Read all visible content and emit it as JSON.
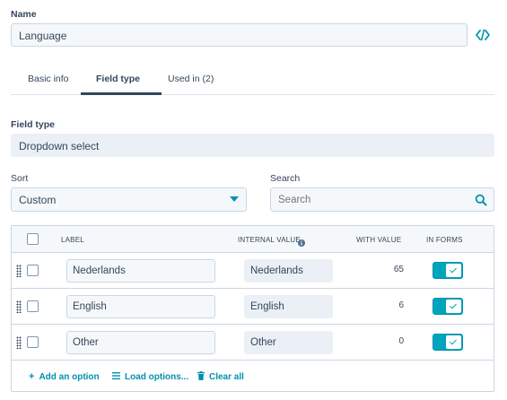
{
  "name_field": {
    "label": "Name",
    "value": "Language"
  },
  "tabs": [
    {
      "label": "Basic info"
    },
    {
      "label": "Field type"
    },
    {
      "label": "Used in (2)"
    }
  ],
  "field_type": {
    "label": "Field type",
    "value": "Dropdown select"
  },
  "sort": {
    "label": "Sort",
    "value": "Custom"
  },
  "search": {
    "label": "Search",
    "placeholder": "Search"
  },
  "table": {
    "headers": {
      "label": "LABEL",
      "internal_value": "INTERNAL VALUE",
      "with_value": "WITH VALUE",
      "in_forms": "IN FORMS"
    },
    "rows": [
      {
        "label": "Nederlands",
        "internal_value": "Nederlands",
        "with_value": "65",
        "in_forms": true
      },
      {
        "label": "English",
        "internal_value": "English",
        "with_value": "6",
        "in_forms": true
      },
      {
        "label": "Other",
        "internal_value": "Other",
        "with_value": "0",
        "in_forms": true
      }
    ]
  },
  "footer": {
    "add_option": "Add an option",
    "load_options": "Load options...",
    "clear_all": "Clear all"
  },
  "colors": {
    "accent": "#00a4bd",
    "link": "#0091ae",
    "text": "#33475b"
  },
  "icons": [
    "code-icon",
    "search-icon",
    "info-icon",
    "drag-handle-icon",
    "plus-icon",
    "list-icon",
    "trash-icon",
    "checkmark-icon",
    "caret-down-icon"
  ]
}
